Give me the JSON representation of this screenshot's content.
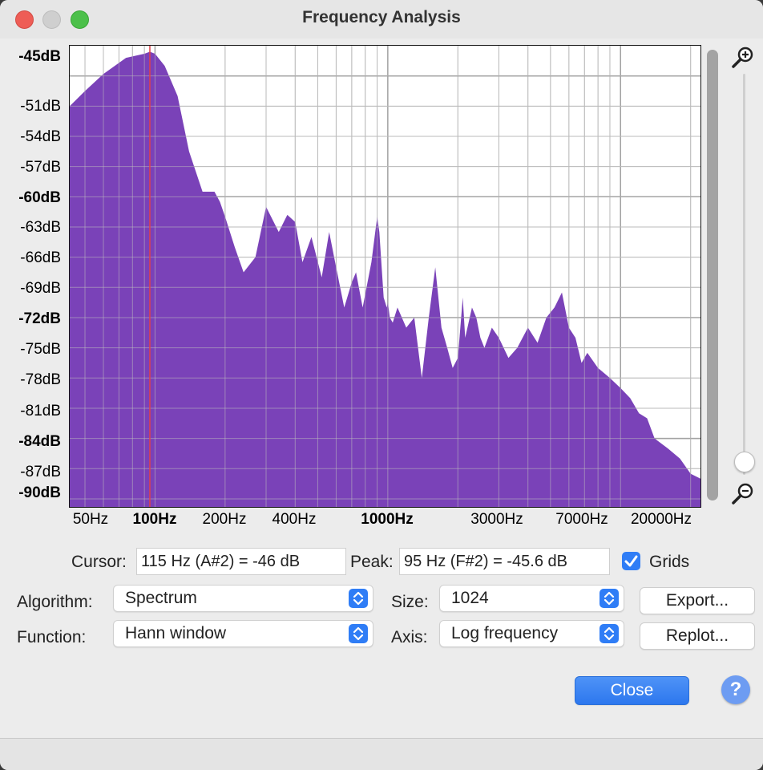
{
  "window": {
    "title": "Frequency Analysis"
  },
  "chart_data": {
    "type": "area",
    "xscale": "log",
    "xlim_hz": [
      43,
      22050
    ],
    "ylim_db": [
      -90.8,
      -45
    ],
    "grid": true,
    "fill_color": "#7a42b8",
    "cursor_line_hz": 95,
    "cursor_line_color": "#e0404a",
    "y_ticks": [
      "-45dB",
      "-51dB",
      "-54dB",
      "-57dB",
      "-60dB",
      "-63dB",
      "-66dB",
      "-69dB",
      "-72dB",
      "-75dB",
      "-78dB",
      "-81dB",
      "-84dB",
      "-87dB",
      "-90dB"
    ],
    "x_ticks": [
      "50Hz",
      "100Hz",
      "200Hz",
      "400Hz",
      "1000Hz",
      "3000Hz",
      "7000Hz",
      "20000Hz"
    ],
    "x_hz": [
      43,
      50,
      60,
      75,
      90,
      95,
      100,
      110,
      125,
      140,
      160,
      180,
      190,
      200,
      220,
      240,
      270,
      300,
      340,
      370,
      400,
      430,
      470,
      520,
      560,
      600,
      650,
      700,
      730,
      780,
      850,
      900,
      920,
      960,
      990,
      1000,
      1020,
      1050,
      1100,
      1200,
      1300,
      1400,
      1500,
      1600,
      1700,
      1800,
      1900,
      2000,
      2100,
      2150,
      2300,
      2400,
      2500,
      2600,
      2800,
      3000,
      3300,
      3600,
      4000,
      4400,
      4800,
      5200,
      5600,
      6000,
      6400,
      6800,
      7200,
      8000,
      9000,
      10000,
      11000,
      12000,
      13000,
      14000,
      16000,
      18000,
      20000,
      22050
    ],
    "y_db": [
      -51,
      -49.5,
      -47.8,
      -46.2,
      -45.8,
      -45.6,
      -45.8,
      -47,
      -50,
      -55.5,
      -59.5,
      -59.5,
      -60.5,
      -62,
      -65,
      -67.5,
      -66,
      -61,
      -63.5,
      -61.8,
      -62.5,
      -66.5,
      -64,
      -68,
      -63.5,
      -67,
      -71,
      -68.5,
      -67.5,
      -71,
      -66.5,
      -62,
      -63.5,
      -70,
      -71,
      -70.5,
      -72,
      -72.5,
      -71,
      -73,
      -72,
      -78,
      -72,
      -67,
      -73,
      -75,
      -77,
      -76,
      -70,
      -74,
      -71,
      -72,
      -74,
      -75,
      -73,
      -74,
      -76,
      -75,
      -73,
      -74.5,
      -72,
      -71,
      -69.5,
      -73,
      -74,
      -76.5,
      -75.5,
      -77,
      -78,
      -79,
      -80,
      -81.5,
      -82,
      -84,
      -85,
      -86,
      -87.5,
      -88
    ]
  },
  "controls": {
    "cursor_label": "Cursor:",
    "cursor_value": "115 Hz (A#2) = -46 dB",
    "peak_label": "Peak:",
    "peak_value": "95 Hz (F#2) = -45.6 dB",
    "grids_label": "Grids",
    "grids_checked": true,
    "algorithm_label": "Algorithm:",
    "algorithm_value": "Spectrum",
    "function_label": "Function:",
    "function_value": "Hann window",
    "size_label": "Size:",
    "size_value": "1024",
    "axis_label": "Axis:",
    "axis_value": "Log frequency",
    "export_label": "Export...",
    "replot_label": "Replot...",
    "close_label": "Close",
    "help_glyph": "?"
  },
  "colors": {
    "accent": "#2f7df6",
    "close_button": "#2f7df6"
  }
}
